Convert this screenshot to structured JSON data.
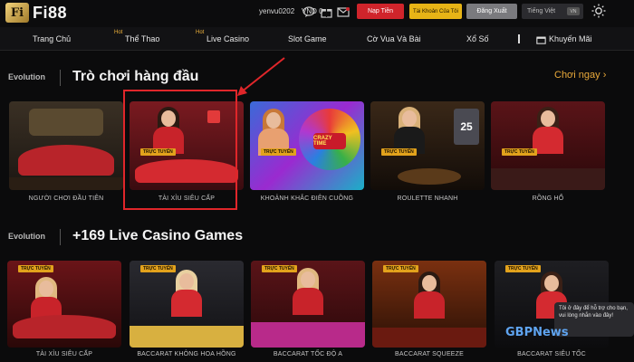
{
  "header": {
    "brand_mark": "Fi",
    "brand_name": "Fi88",
    "username": "yenvu0202",
    "balance": "VND 0",
    "icons": [
      "chat-icon",
      "gift-icon",
      "mail-icon",
      "wallet-icon"
    ],
    "deposit_label": "Nạp Tiền",
    "account_label": "Tài Khoản Của Tôi",
    "logout_label": "Đăng Xuất",
    "language_label": "Tiếng Việt",
    "language_code": "VN",
    "theme_icon": "sun-icon"
  },
  "nav": {
    "items": [
      {
        "label": "Trang Chủ",
        "hot": ""
      },
      {
        "label": "Thể Thao",
        "hot": "Hot"
      },
      {
        "label": "Live Casino",
        "hot": "Hot"
      },
      {
        "label": "Slot Game",
        "hot": ""
      },
      {
        "label": "Cờ Vua Và Bài",
        "hot": ""
      },
      {
        "label": "Xổ Số",
        "hot": ""
      },
      {
        "label": "Khuyến Mãi",
        "hot": ""
      }
    ],
    "promo_icon": "gift-icon"
  },
  "top_games": {
    "brand": "Evolution",
    "title": "Trò chơi hàng đầu",
    "play_now": "Chơi ngay",
    "badge": "TRỰC TUYẾN",
    "cards": [
      {
        "caption": "NGƯỜI CHƠI ĐẦU TIÊN"
      },
      {
        "caption": "TÀI XỈU SIÊU CẤP"
      },
      {
        "caption": "KHOẢNH KHẮC ĐIÊN CUỒNG",
        "overlay": "CRAZY TIME"
      },
      {
        "caption": "ROULETTE NHANH",
        "overlay": "25"
      },
      {
        "caption": "RỒNG HỔ"
      }
    ]
  },
  "live_games": {
    "brand": "Evolution",
    "title": "+169 Live Casino Games",
    "badge": "TRỰC TUYẾN",
    "cards": [
      {
        "caption": "TÀI XỈU SIÊU CẤP"
      },
      {
        "caption": "BACCARAT KHÔNG HOA HỒNG"
      },
      {
        "caption": "BACCARAT TỐC ĐỘ A"
      },
      {
        "caption": "BACCARAT SQUEEZE"
      },
      {
        "caption": "BACCARAT SIÊU TỐC"
      }
    ]
  },
  "chat": {
    "message": "Tôi ở đây để hỗ trợ cho bạn, vui lòng nhắn vào đây!"
  },
  "watermark": "GBPNews",
  "colors": {
    "accent_gold": "#e9a93a",
    "deposit_red": "#d0242b",
    "account_yellow": "#e7b416",
    "highlight_red": "#e0262a"
  }
}
